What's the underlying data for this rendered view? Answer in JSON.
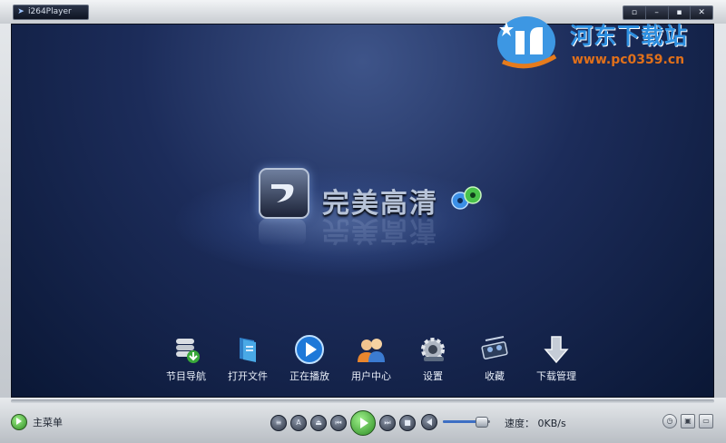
{
  "titlebar": {
    "app_name": "i264Player",
    "controls": [
      "▫",
      "–",
      "▪",
      "✕"
    ]
  },
  "watermark": {
    "site_name": "河东下载站",
    "url": "www.pc0359.cn"
  },
  "splash": {
    "brand_text": "完美高清"
  },
  "menu": {
    "items": [
      {
        "label": "节目导航",
        "icon": "database-download-icon"
      },
      {
        "label": "打开文件",
        "icon": "folder-book-icon"
      },
      {
        "label": "正在播放",
        "icon": "play-circle-icon"
      },
      {
        "label": "用户中心",
        "icon": "users-icon"
      },
      {
        "label": "设置",
        "icon": "gear-icon"
      },
      {
        "label": "收藏",
        "icon": "film-reel-icon"
      },
      {
        "label": "下载管理",
        "icon": "download-arrow-icon"
      }
    ]
  },
  "bottom": {
    "main_menu_label": "主菜单",
    "control_glyphs": {
      "list": "≡",
      "text": "A",
      "eject": "⏏",
      "prev": "⏮",
      "next": "⏭",
      "stop": "■"
    },
    "speed_text": "速度： 0KB/s",
    "volume_level": 0.8
  },
  "colors": {
    "screen_bg": "#1c2c5a",
    "accent_green": "#2b8b22",
    "watermark_blue": "#2d8fe0",
    "watermark_orange": "#e0701a"
  }
}
